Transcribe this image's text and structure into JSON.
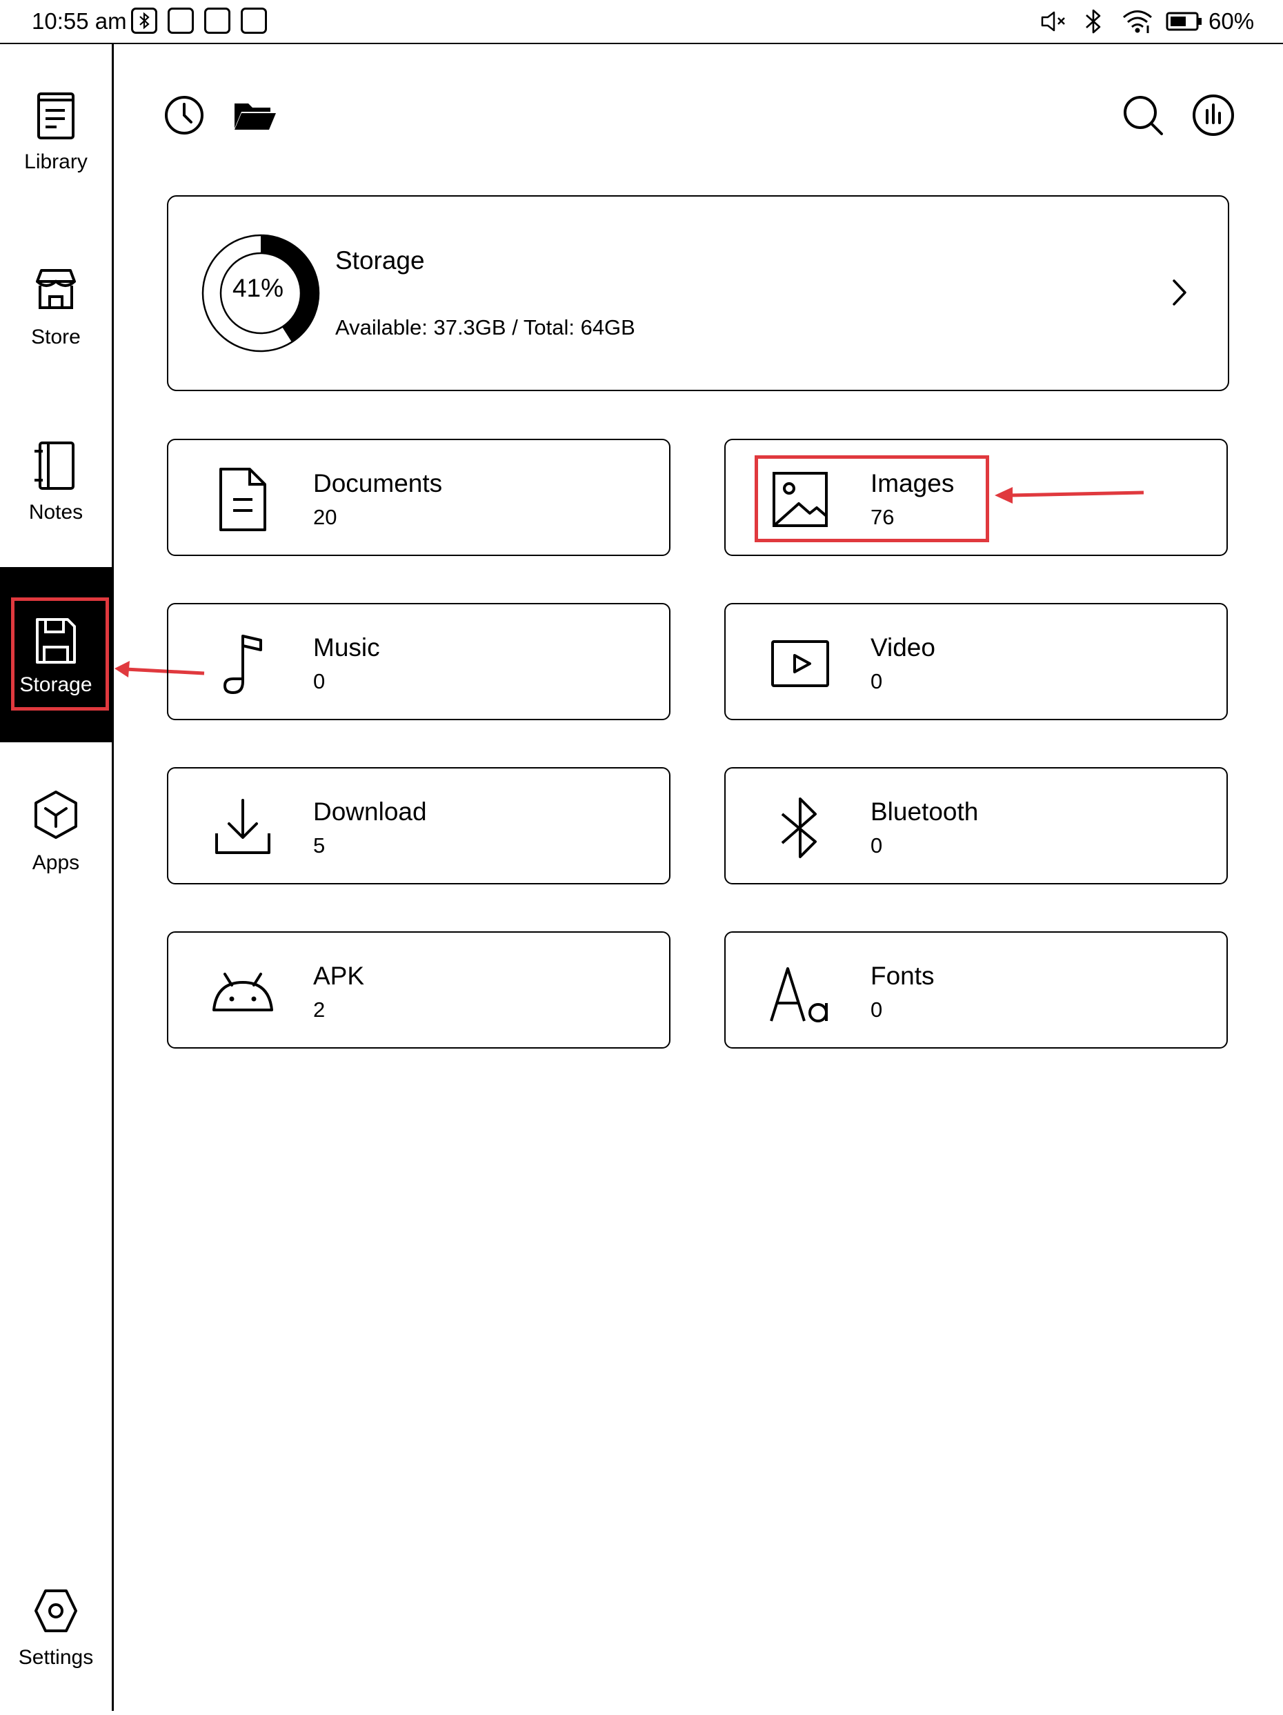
{
  "status_bar": {
    "time": "10:55 am",
    "battery": "60%",
    "icons": [
      "bluetooth-box-icon",
      "notification-box-icon",
      "notification-box-icon",
      "notification-box-icon",
      "mute-icon",
      "bluetooth-icon",
      "wifi-icon",
      "battery-icon"
    ]
  },
  "sidebar": {
    "items": [
      {
        "label": "Library",
        "icon": "library-icon"
      },
      {
        "label": "Store",
        "icon": "store-icon"
      },
      {
        "label": "Notes",
        "icon": "notes-icon"
      },
      {
        "label": "Storage",
        "icon": "storage-icon",
        "active": true
      },
      {
        "label": "Apps",
        "icon": "apps-icon"
      },
      {
        "label": "Settings",
        "icon": "settings-icon"
      }
    ]
  },
  "toolbar": {
    "icons": [
      "recent-clock-icon",
      "folder-icon",
      "search-icon",
      "stats-icon"
    ]
  },
  "storage": {
    "title": "Storage",
    "percent_label": "41%",
    "used_fraction": 0.41,
    "details": "Available: 37.3GB / Total: 64GB"
  },
  "categories": [
    {
      "name": "Documents",
      "count": "20",
      "icon": "document-icon"
    },
    {
      "name": "Images",
      "count": "76",
      "icon": "image-icon"
    },
    {
      "name": "Music",
      "count": "0",
      "icon": "music-icon"
    },
    {
      "name": "Video",
      "count": "0",
      "icon": "video-icon"
    },
    {
      "name": "Download",
      "count": "5",
      "icon": "download-icon"
    },
    {
      "name": "Bluetooth",
      "count": "0",
      "icon": "bluetooth-icon"
    },
    {
      "name": "APK",
      "count": "2",
      "icon": "android-icon"
    },
    {
      "name": "Fonts",
      "count": "0",
      "icon": "font-icon"
    }
  ],
  "annotation_color": "#e0393e"
}
